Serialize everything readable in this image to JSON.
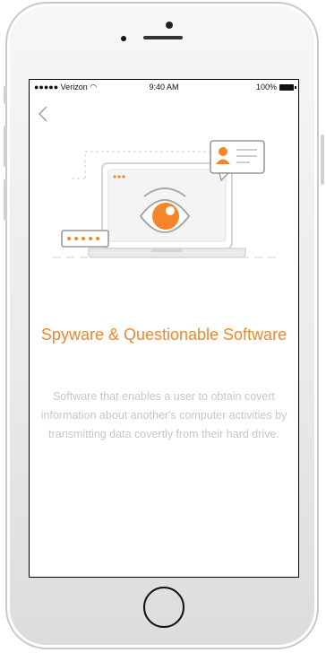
{
  "status_bar": {
    "carrier": "●●●●● Verizon ◠",
    "time": "9:40 AM",
    "battery": "100%"
  },
  "nav": {
    "back_label": "‹"
  },
  "content": {
    "title": "Spyware & Questionable Software",
    "description": "Software that enables a user to obtain covert information about another's computer activities by transmitting data covertly from their hard drive."
  },
  "colors": {
    "accent": "#f5852a",
    "muted_text": "#c7c7c7",
    "line": "#d6d6d6"
  }
}
